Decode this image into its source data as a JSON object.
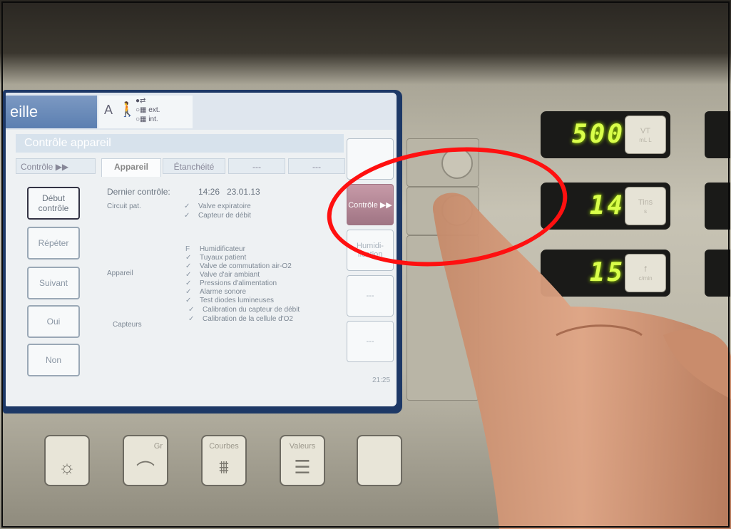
{
  "screen": {
    "mode_label": "eille",
    "status": {
      "letter": "A",
      "ext": "ext.",
      "int": "int."
    },
    "section_title": "Contrôle appareil",
    "tabs": [
      "Contrôle ▶▶",
      "Appareil",
      "Étanchéité",
      "---",
      "---"
    ],
    "left_buttons": [
      "Début contrôle",
      "Répéter",
      "Suivant",
      "Oui",
      "Non"
    ],
    "last_check_label": "Dernier contrôle:",
    "last_check_time": "14:26",
    "last_check_date": "23.01.13",
    "groups": {
      "circuit": "Circuit pat.",
      "appareil": "Appareil",
      "capteurs": "Capteurs"
    },
    "checks": [
      {
        "mark": "✓",
        "label": "Valve expiratoire"
      },
      {
        "mark": "✓",
        "label": "Capteur de débit"
      },
      {
        "mark": "F",
        "label": "Humidificateur"
      },
      {
        "mark": "✓",
        "label": "Tuyaux patient"
      },
      {
        "mark": "✓",
        "label": "Valve de commutation air-O2"
      },
      {
        "mark": "✓",
        "label": "Valve d'air ambiant"
      },
      {
        "mark": "✓",
        "label": "Pressions d'alimentation"
      },
      {
        "mark": "✓",
        "label": "Alarme sonore"
      },
      {
        "mark": "✓",
        "label": "Test diodes lumineuses"
      },
      {
        "mark": "✓",
        "label": "Calibration du capteur de débit"
      },
      {
        "mark": "✓",
        "label": "Calibration de la cellule d'O2"
      }
    ],
    "right_buttons": [
      "",
      "Contrôle ▶▶",
      "Humidi- fication",
      "---",
      "---"
    ],
    "clock": "21:25"
  },
  "readouts": [
    {
      "value": "500",
      "unit": "VT",
      "sub": "mL L"
    },
    {
      "value": "14",
      "unit": "Tins",
      "sub": "s"
    },
    {
      "value": "15",
      "unit": "f",
      "sub": "c/min"
    }
  ],
  "hardware_keys": [
    {
      "label": "",
      "icon": "brightness-icon"
    },
    {
      "label": "Gr",
      "icon": "curve-icon"
    },
    {
      "label": "Courbes",
      "icon": "curves-icon"
    },
    {
      "label": "Valeurs",
      "icon": "values-icon"
    },
    {
      "label": "",
      "icon": "blank-key"
    }
  ],
  "colors": {
    "led": "#d9ff4a",
    "annotation": "#ff1010",
    "active_button": "#a07584"
  }
}
